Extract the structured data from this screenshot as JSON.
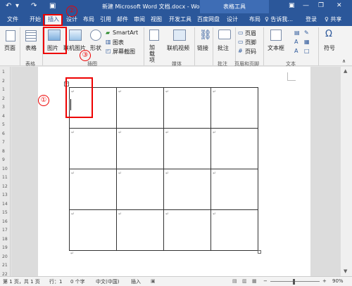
{
  "titlebar": {
    "undo_glyph": "↶",
    "redo_glyph": "↷",
    "save_glyph": "▣",
    "title": "新建 Microsoft Word 文档.docx - Word",
    "tools_tab": "表格工具",
    "min": "—",
    "restore": "❐",
    "close": "✕"
  },
  "tabs": [
    "文件",
    "开始",
    "插入",
    "设计",
    "布局",
    "引用",
    "邮件",
    "审阅",
    "视图",
    "开发工具",
    "百度网盘",
    "设计",
    "布局"
  ],
  "tabbar": {
    "search": "♀ 告诉我...",
    "login": "登录",
    "share": "♀ 共享"
  },
  "ribbon": {
    "page": "页面",
    "table": "表格",
    "picture": "图片",
    "online_picture": "联机图片",
    "shapes": "形状",
    "smartart": "SmartArt",
    "chart": "图表",
    "screenshot": "屏幕截图",
    "addins": "加载项",
    "online_video": "联机视频",
    "link": "链接",
    "comment": "批注",
    "header": "页眉",
    "footer": "页脚",
    "page_number": "页码",
    "textbox": "文本框",
    "symbol": "符号",
    "omega": "Ω",
    "groups": {
      "tables": "表格",
      "illustrations": "插图",
      "media": "媒体",
      "comments": "批注",
      "header_footer": "页眉和页脚",
      "text": "文本"
    }
  },
  "ruler": [
    "1",
    "2",
    "1",
    "2",
    "3",
    "4",
    "5",
    "6",
    "7",
    "8",
    "9",
    "10",
    "11",
    "12",
    "13",
    "14",
    "15",
    "16",
    "17",
    "18",
    "19",
    "20",
    "21",
    "22"
  ],
  "doc": {
    "para_mark": "↵",
    "table_handle": "+"
  },
  "status": {
    "page": "第 1 页，共 1 页",
    "line": "行：1",
    "words": "0 个字",
    "language": "中文(中国)",
    "mode": "插入",
    "zoom_minus": "−",
    "zoom_plus": "+",
    "zoom": "90%"
  },
  "annotations": {
    "step1": "①",
    "step2": "②",
    "step3": "③"
  }
}
